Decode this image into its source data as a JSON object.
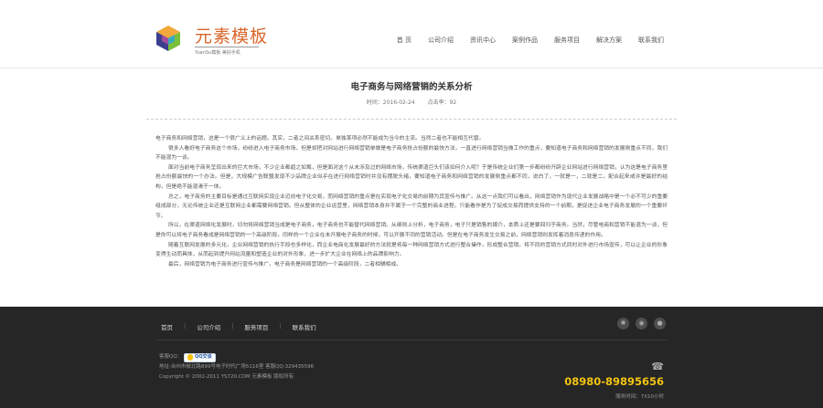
{
  "site": {
    "logo_name": "元素模板",
    "logo_tagline": "YuanSu模板 美好手机",
    "accent": "#d9662a"
  },
  "nav": [
    "首 页",
    "公司介绍",
    "资讯中心",
    "案例作品",
    "服务项目",
    "解决方案",
    "联系我们"
  ],
  "article": {
    "title": "电子商务与网络营销的关系分析",
    "time": "时间：2016-02-24",
    "clicks": "点击率：92",
    "paragraphs": [
      "电子商务和网络营销，这是一个很广义上的话题。其实，二者之间关系密切。单独某项必然不能成为当今的主流。当然二者也不能相互代替。",
      "很多人看好电子商务这个市场，纷纷进入电子商务市场，但是却把对网站进行网络营销单做是电子商务抢占份额的最快方法，一直进行网络营销当做工作的重点，要知道电子商务和网络营销的发展侧重点不同，我们不能混为一谈。",
      "面对当前电子商务呈现出来的巨大市场，不少企业都趋之如鹜，但是面对这个从未涉及过的网络市场，传统渠道巨头们该如何介入呢？于是传统企业们第一步都纷纷开辟企业网站进行网络营销，认为这是电子商务里抢占份额最快的一个办法。但是，大规模广告联盟发现不少品牌企业似乎在进行网络营销时并没有摆脱头绪，要知道电子商务和网络营销的发展侧重点都不同，说白了，一就是一，二就是二，配合起来或许是最好的结构，但是绝不能混淆于一体。",
      "总之，电子商务的主要目标是通过互联网实现企业迈向电子化交易，而网络营销的重点是在实现电子化交易的前期为其宣传与推广。从这一点我们可以看出，网络营销作为现代企业发展战略中是一个必不可少的重要组成部分，无论传统企业还是互联网企业都需要网络营销。但从整体的企业运营里，网络营销本身并不属于一个完整的商业进程，只能看作是为了促成交易而提供支持的一个前期，是促进企业电子商务发展的一个重要环节。",
      "所以，在渠道网络化发展时，切勿将网络营销当成是电子商务，电子商务也不能替代网络营销。从细则上分析，电子商务，电子只是销售的媒介，本质上还是要回归于商务。当然，尽管电商和营销不能混为一谈，但是你可以将电子商务看成是网络营销的一个高级阶段，同样的一个企业在未开展电子商务的时候，可以开展不同的营销活动。但是在电子商务发生交易之前，网络营销则发挥着消息传递的作用。",
      "随着互联网发展的多元化，企业网络营销的执行手段也多样化，而企业电商化发展最好的方法就是将每一种网络营销方式进行整合操作，形成整合营销。将不同的营销方式同时对外进行市场宣传，可以让企业的形象变得生动而具体，从而起到提升网站流量和塑造企业的对外形象，进一步扩大企业在网络上的品牌影响力。",
      "最后，网络营销为电子商务进行宣传与推广。电子商务是网络营销的一个高级阶段，二者相辅相成。"
    ]
  },
  "footer": {
    "nav": [
      "首页",
      "公司介绍",
      "服务项目",
      "联系我们"
    ],
    "qq_label": "客服QQ：",
    "qq_badge": "QQ交谈",
    "address": "地址:台州市椒北路899号电子时代广场5116室 客服QQ:329435596",
    "copyright": "Copyright © 2002-2011 YS720.COM 元素模板 版权所有",
    "phone": "08980-89895656",
    "hours": "服务时间：7X10小时",
    "phone_color": "#f2c40f"
  }
}
